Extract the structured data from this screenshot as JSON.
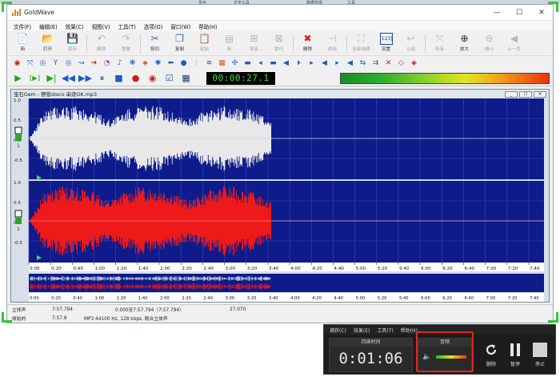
{
  "top_strip": [
    "显示",
    "文字工具",
    "数据选择",
    "工具"
  ],
  "window": {
    "title": "GoldWave",
    "controls": [
      "—",
      "☐",
      "✕"
    ]
  },
  "menu": [
    "文件(F)",
    "编辑(E)",
    "效果(C)",
    "视图(V)",
    "工具(T)",
    "选项(O)",
    "窗口(W)",
    "帮助(H)"
  ],
  "toolbar_main": [
    {
      "name": "new",
      "label": "新",
      "glyph": "📄",
      "disabled": false
    },
    {
      "name": "open",
      "label": "打开",
      "glyph": "📂",
      "disabled": false
    },
    {
      "name": "save",
      "label": "保存",
      "glyph": "💾",
      "disabled": true
    },
    {
      "name": "undo",
      "label": "撤销",
      "glyph": "↶",
      "disabled": true
    },
    {
      "name": "redo",
      "label": "重做",
      "glyph": "↷",
      "disabled": true
    },
    {
      "name": "cut",
      "label": "剪切",
      "glyph": "✂",
      "disabled": false
    },
    {
      "name": "copy",
      "label": "复制",
      "glyph": "❐",
      "disabled": false
    },
    {
      "name": "paste",
      "label": "粘贴",
      "glyph": "📋",
      "disabled": true
    },
    {
      "name": "paste-new",
      "label": "新",
      "glyph": "▤",
      "disabled": true
    },
    {
      "name": "mix",
      "label": "混音",
      "glyph": "⊞",
      "disabled": true
    },
    {
      "name": "replace",
      "label": "替代",
      "glyph": "⊠",
      "disabled": true
    },
    {
      "name": "delete",
      "label": "删除",
      "glyph": "✖",
      "disabled": false
    },
    {
      "name": "trim",
      "label": "修剪",
      "glyph": "⊣",
      "disabled": true
    },
    {
      "name": "select-all",
      "label": "全部选择",
      "glyph": "⛶",
      "disabled": true
    },
    {
      "name": "set",
      "label": "设置",
      "glyph": "[123]",
      "disabled": false
    },
    {
      "name": "previous",
      "label": "以前",
      "glyph": "↩",
      "disabled": true
    },
    {
      "name": "all",
      "label": "所有",
      "glyph": "⤧",
      "disabled": true
    },
    {
      "name": "zoom-in",
      "label": "放大",
      "glyph": "⊕",
      "disabled": false
    },
    {
      "name": "zoom-out",
      "label": "缩小",
      "glyph": "⊖",
      "disabled": true
    },
    {
      "name": "prev-page",
      "label": "上一页",
      "glyph": "◀",
      "disabled": true
    }
  ],
  "toolbar_effects_glyphs": [
    "◉",
    "⤧",
    "◎",
    "Y",
    "◎",
    "↝",
    "➔",
    "◔",
    "♪",
    "❋",
    "◈",
    "✺",
    "⬅",
    "●",
    "⫶",
    "≋",
    "▦",
    "✣",
    "▬",
    "◂",
    "▬",
    "◀",
    "⏵",
    "▸",
    "◀",
    "▸",
    "◀",
    "⇆",
    "⇉",
    "✕",
    "◇",
    "◈"
  ],
  "transport": {
    "counter": "00:00:27.1",
    "buttons": [
      "▶",
      "⟦▶⟧",
      "▶|",
      "◀◀",
      "▶▶",
      "⏸",
      "■",
      "●",
      "◉",
      "☑",
      "▦"
    ]
  },
  "document": {
    "title": "宝石Gem - 野狼disco 串烧OK.mp3",
    "controls": [
      "_",
      "☐",
      "✕"
    ],
    "y_labels_top": [
      "1.0",
      "0.5",
      "0.0",
      "-0.5"
    ],
    "y_labels_bottom": [
      "1.0",
      "0.5",
      "0.0",
      "-0.5"
    ],
    "timeline": [
      "0:00",
      "0:20",
      "0:40",
      "1:00",
      "1:20",
      "1:40",
      "2:00",
      "2:20",
      "2:40",
      "3:00",
      "3:20",
      "3:40",
      "4:00",
      "4:20",
      "4:40",
      "5:00",
      "5:20",
      "5:40",
      "6:00",
      "6:20",
      "6:40",
      "7:00",
      "7:20",
      "7:40"
    ],
    "channel_marker": "1",
    "colors": {
      "background": "#0e1b8a",
      "left_wave": "#e8e8e8",
      "right_wave": "#ee1a1a",
      "grid": "#3a4ac4"
    }
  },
  "status": {
    "row1": {
      "mode": "立体声",
      "length": "7:57.794",
      "selection": "0.000至7:57.794（7:57.794）",
      "zoom": "27.070"
    },
    "row2": {
      "mode": "原始的",
      "length": "7:57.8",
      "format": "MP3 44100 Hz, 128 kbps, 联合立体声"
    }
  },
  "recorder": {
    "menu": [
      "捕获(C)",
      "效果(E)",
      "工具(T)",
      "帮助(H)"
    ],
    "duration_title": "持续时间",
    "duration": "0:01:06",
    "audio_title": "音频",
    "buttons": [
      {
        "name": "delete",
        "label": "删除"
      },
      {
        "name": "pause",
        "label": "暂停"
      },
      {
        "name": "stop",
        "label": "停止"
      }
    ]
  }
}
